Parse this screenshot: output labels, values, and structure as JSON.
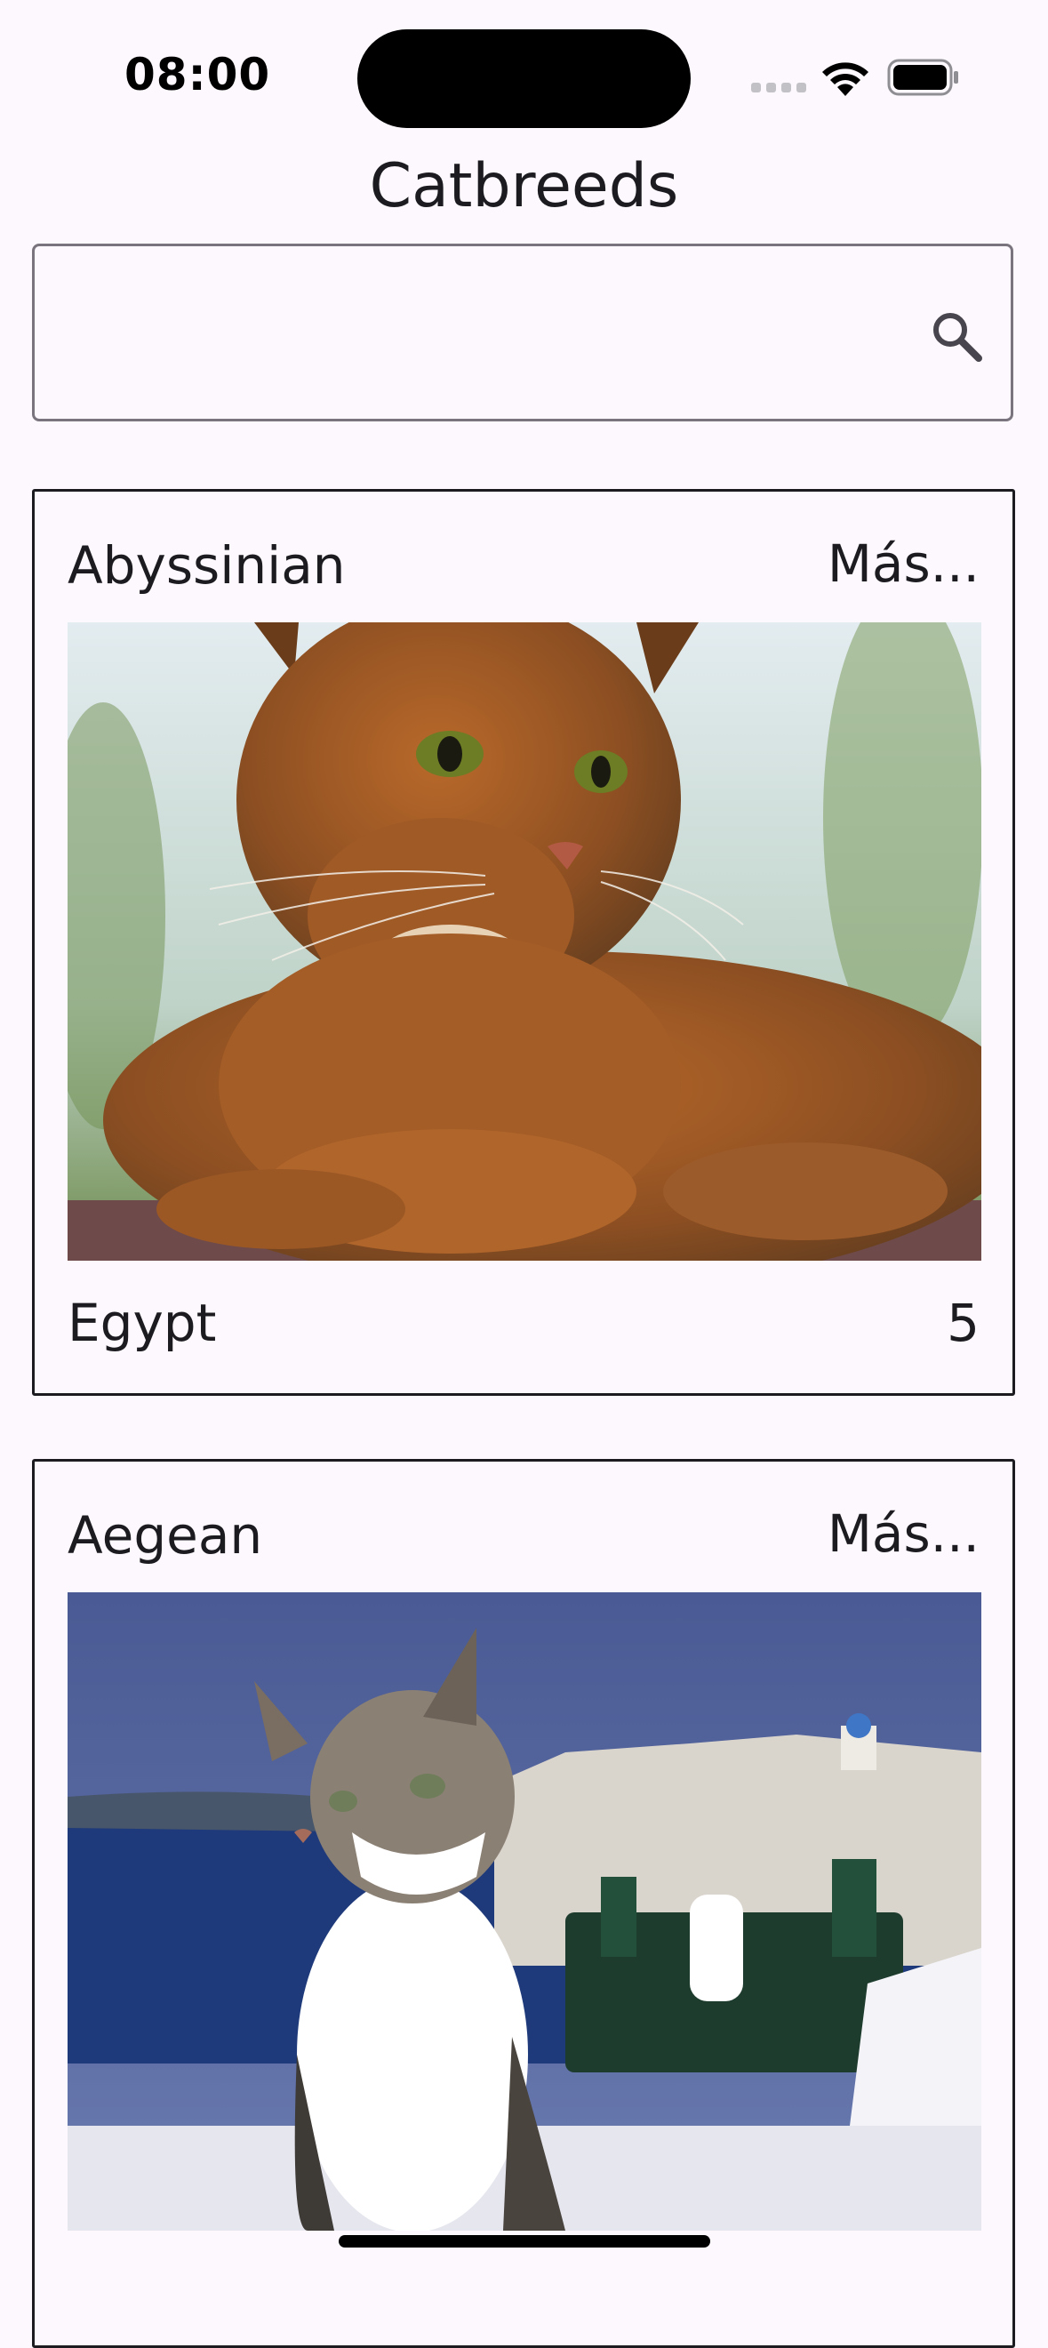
{
  "status_bar": {
    "time": "08:00",
    "icons": [
      "cellular-signal-icon",
      "wifi-icon",
      "battery-icon"
    ]
  },
  "header": {
    "title": "Catbreeds"
  },
  "search": {
    "value": "",
    "placeholder": "",
    "icon": "search-icon"
  },
  "breeds": [
    {
      "name": "Abyssinian",
      "more_label": "Más...",
      "image": "photo of a ruddy brown cat lying down",
      "origin": "Egypt",
      "rating": "5"
    },
    {
      "name": "Aegean",
      "more_label": "Más...",
      "image": "photo of a tabby and white cat with a white village and sea behind"
    }
  ],
  "colors": {
    "background": "#fdf8fd",
    "text": "#1c1b1f",
    "outline": "#79747e"
  }
}
